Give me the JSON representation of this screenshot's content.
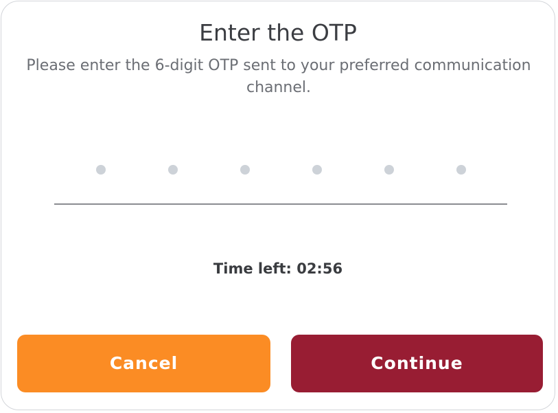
{
  "dialog": {
    "title": "Enter the OTP",
    "subtitle": "Please enter the 6-digit OTP sent to your preferred communication channel."
  },
  "otp": {
    "digit_count": 6,
    "entered_value": ""
  },
  "timer": {
    "text": "Time left: 02:56"
  },
  "buttons": {
    "cancel_label": "Cancel",
    "continue_label": "Continue"
  },
  "colors": {
    "cancel_button": "#fb8c24",
    "continue_button": "#981d33",
    "otp_placeholder_dot": "#cdd2d8",
    "dialog_border": "#d3d5da"
  }
}
